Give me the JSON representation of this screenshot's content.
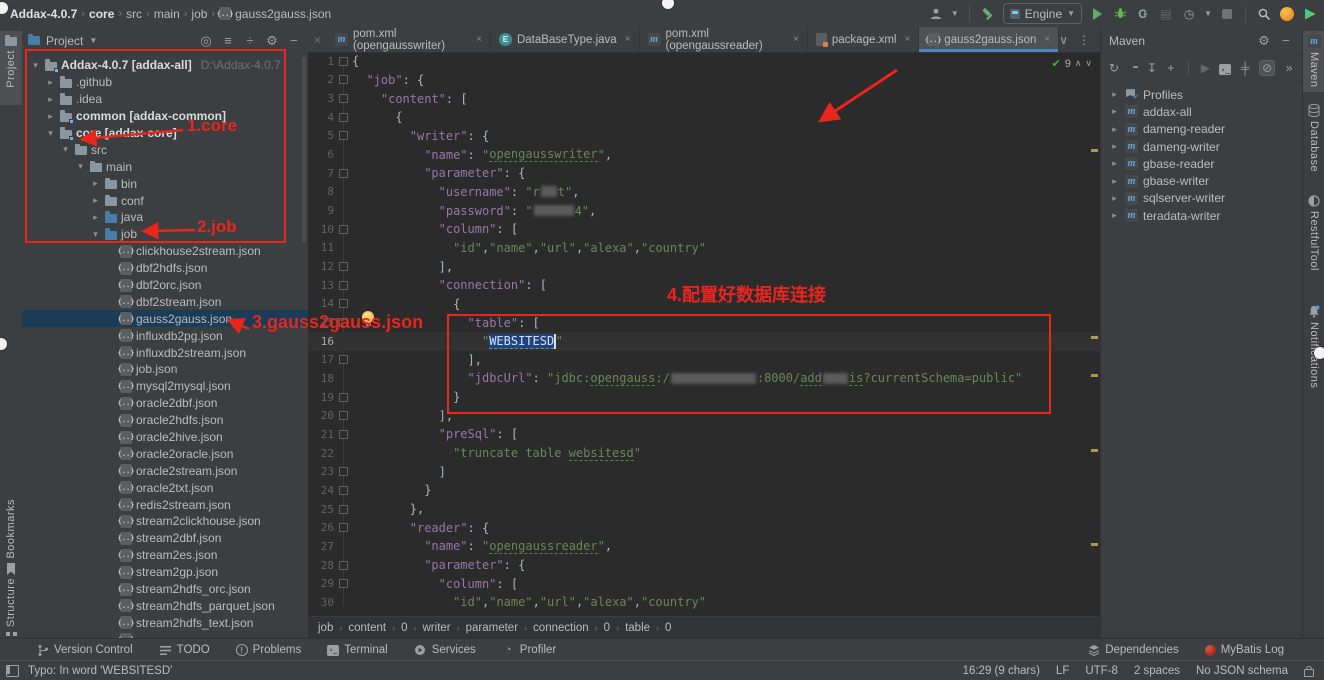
{
  "titlebar": {
    "breadcrumbs": [
      "Addax-4.0.7",
      "core",
      "src",
      "main",
      "job",
      "gauss2gauss.json"
    ],
    "run_config": "Engine"
  },
  "tabs": [
    {
      "icon": "maven",
      "label": "pom.xml (opengausswriter)"
    },
    {
      "icon": "enum",
      "label": "DataBaseType.java"
    },
    {
      "icon": "maven",
      "label": "pom.xml (opengaussreader)"
    },
    {
      "icon": "pkg",
      "label": "package.xml"
    },
    {
      "icon": "json",
      "label": "gauss2gauss.json",
      "active": true
    }
  ],
  "inspection": {
    "count": "9"
  },
  "project": {
    "title": "Project",
    "tree": [
      {
        "l": 0,
        "a": "v",
        "i": "module",
        "t": "Addax-4.0.7 [addax-all]",
        "b": true,
        "suf": "D:\\Addax-4.0.7"
      },
      {
        "l": 1,
        "a": ">",
        "i": "folder",
        "t": ".github"
      },
      {
        "l": 1,
        "a": ">",
        "i": "folder",
        "t": ".idea"
      },
      {
        "l": 1,
        "a": ">",
        "i": "module",
        "t": "common [addax-common]",
        "b": true
      },
      {
        "l": 1,
        "a": "v",
        "i": "module",
        "t": "core [addax-core]",
        "b": true
      },
      {
        "l": 2,
        "a": "v",
        "i": "folder",
        "t": "src"
      },
      {
        "l": 3,
        "a": "v",
        "i": "folder",
        "t": "main"
      },
      {
        "l": 4,
        "a": ">",
        "i": "folder",
        "t": "bin"
      },
      {
        "l": 4,
        "a": ">",
        "i": "folder",
        "t": "conf"
      },
      {
        "l": 4,
        "a": ">",
        "i": "folderb",
        "t": "java"
      },
      {
        "l": 4,
        "a": "v",
        "i": "folderb",
        "t": "job"
      },
      {
        "l": 5,
        "a": "",
        "i": "json",
        "t": "clickhouse2stream.json"
      },
      {
        "l": 5,
        "a": "",
        "i": "json",
        "t": "dbf2hdfs.json"
      },
      {
        "l": 5,
        "a": "",
        "i": "json",
        "t": "dbf2orc.json"
      },
      {
        "l": 5,
        "a": "",
        "i": "json",
        "t": "dbf2stream.json"
      },
      {
        "l": 5,
        "a": "",
        "i": "json",
        "t": "gauss2gauss.json",
        "sel": true
      },
      {
        "l": 5,
        "a": "",
        "i": "json",
        "t": "influxdb2pg.json"
      },
      {
        "l": 5,
        "a": "",
        "i": "json",
        "t": "influxdb2stream.json"
      },
      {
        "l": 5,
        "a": "",
        "i": "json",
        "t": "job.json"
      },
      {
        "l": 5,
        "a": "",
        "i": "json",
        "t": "mysql2mysql.json"
      },
      {
        "l": 5,
        "a": "",
        "i": "json",
        "t": "oracle2dbf.json"
      },
      {
        "l": 5,
        "a": "",
        "i": "json",
        "t": "oracle2hdfs.json"
      },
      {
        "l": 5,
        "a": "",
        "i": "json",
        "t": "oracle2hive.json"
      },
      {
        "l": 5,
        "a": "",
        "i": "json",
        "t": "oracle2oracle.json"
      },
      {
        "l": 5,
        "a": "",
        "i": "json",
        "t": "oracle2stream.json"
      },
      {
        "l": 5,
        "a": "",
        "i": "json",
        "t": "oracle2txt.json"
      },
      {
        "l": 5,
        "a": "",
        "i": "json",
        "t": "redis2stream.json"
      },
      {
        "l": 5,
        "a": "",
        "i": "json",
        "t": "stream2clickhouse.json"
      },
      {
        "l": 5,
        "a": "",
        "i": "json",
        "t": "stream2dbf.json"
      },
      {
        "l": 5,
        "a": "",
        "i": "json",
        "t": "stream2es.json"
      },
      {
        "l": 5,
        "a": "",
        "i": "json",
        "t": "stream2gp.json"
      },
      {
        "l": 5,
        "a": "",
        "i": "json",
        "t": "stream2hdfs_orc.json"
      },
      {
        "l": 5,
        "a": "",
        "i": "json",
        "t": "stream2hdfs_parquet.json"
      },
      {
        "l": 5,
        "a": "",
        "i": "json",
        "t": "stream2hdfs_text.json"
      },
      {
        "l": 5,
        "a": "",
        "i": "json",
        "t": ""
      }
    ]
  },
  "editor": {
    "caret_line": 16,
    "lines": [
      {
        "n": 1,
        "ind": 0,
        "f": "o",
        "seg": [
          [
            "p",
            "{"
          ]
        ]
      },
      {
        "n": 2,
        "ind": 2,
        "f": "o",
        "seg": [
          [
            "k",
            "\"job\""
          ],
          [
            "p",
            ": {"
          ]
        ]
      },
      {
        "n": 3,
        "ind": 4,
        "f": "o",
        "seg": [
          [
            "k",
            "\"content\""
          ],
          [
            "p",
            ": ["
          ]
        ]
      },
      {
        "n": 4,
        "ind": 6,
        "f": "o",
        "seg": [
          [
            "p",
            "{"
          ]
        ]
      },
      {
        "n": 5,
        "ind": 8,
        "f": "o",
        "seg": [
          [
            "k",
            "\"writer\""
          ],
          [
            "p",
            ": {"
          ]
        ]
      },
      {
        "n": 6,
        "ind": 10,
        "f": "",
        "seg": [
          [
            "k",
            "\"name\""
          ],
          [
            "p",
            ": "
          ],
          [
            "s",
            "\""
          ],
          [
            "u",
            "opengausswriter"
          ],
          [
            "s",
            "\""
          ],
          [
            "p",
            ","
          ]
        ]
      },
      {
        "n": 7,
        "ind": 10,
        "f": "o",
        "seg": [
          [
            "k",
            "\"parameter\""
          ],
          [
            "p",
            ": {"
          ]
        ]
      },
      {
        "n": 8,
        "ind": 12,
        "f": "",
        "seg": [
          [
            "k",
            "\"username\""
          ],
          [
            "p",
            ": "
          ],
          [
            "s",
            "\"r"
          ],
          [
            "b",
            "16"
          ],
          [
            "s",
            "t\""
          ],
          [
            "p",
            ","
          ]
        ]
      },
      {
        "n": 9,
        "ind": 12,
        "f": "",
        "seg": [
          [
            "k",
            "\"password\""
          ],
          [
            "p",
            ": "
          ],
          [
            "s",
            "\""
          ],
          [
            "b",
            "40"
          ],
          [
            "s",
            "4\""
          ],
          [
            "p",
            ","
          ]
        ]
      },
      {
        "n": 10,
        "ind": 12,
        "f": "o",
        "seg": [
          [
            "k",
            "\"column\""
          ],
          [
            "p",
            ": ["
          ]
        ]
      },
      {
        "n": 11,
        "ind": 14,
        "f": "",
        "seg": [
          [
            "s",
            "\"id\""
          ],
          [
            "p",
            ","
          ],
          [
            "s",
            "\"name\""
          ],
          [
            "p",
            ","
          ],
          [
            "s",
            "\"url\""
          ],
          [
            "p",
            ","
          ],
          [
            "s",
            "\"alexa\""
          ],
          [
            "p",
            ","
          ],
          [
            "s",
            "\"country\""
          ]
        ]
      },
      {
        "n": 12,
        "ind": 12,
        "f": "e",
        "seg": [
          [
            "p",
            "],"
          ]
        ]
      },
      {
        "n": 13,
        "ind": 12,
        "f": "o",
        "seg": [
          [
            "k",
            "\"connection\""
          ],
          [
            "p",
            ": ["
          ]
        ]
      },
      {
        "n": 14,
        "ind": 14,
        "f": "o",
        "seg": [
          [
            "p",
            "{"
          ]
        ]
      },
      {
        "n": 15,
        "ind": 16,
        "f": "o",
        "seg": [
          [
            "k",
            "\"table\""
          ],
          [
            "p",
            ": ["
          ]
        ]
      },
      {
        "n": 16,
        "ind": 18,
        "f": "",
        "seg": [
          [
            "s",
            "\""
          ],
          [
            "sel",
            "WEBSITESD"
          ],
          [
            "c",
            ""
          ],
          [
            "s",
            "\""
          ]
        ]
      },
      {
        "n": 17,
        "ind": 16,
        "f": "e",
        "seg": [
          [
            "p",
            "],"
          ]
        ]
      },
      {
        "n": 18,
        "ind": 16,
        "f": "",
        "seg": [
          [
            "k",
            "\"jdbcUrl\""
          ],
          [
            "p",
            ": "
          ],
          [
            "s",
            "\"jdbc:"
          ],
          [
            "u",
            "opengauss"
          ],
          [
            "s",
            ":/"
          ],
          [
            "b",
            "85"
          ],
          [
            "s",
            ":8000/"
          ],
          [
            "u",
            "add"
          ],
          [
            "b",
            "25"
          ],
          [
            "u",
            "is"
          ],
          [
            "s",
            "?currentSchema=public\""
          ]
        ]
      },
      {
        "n": 19,
        "ind": 14,
        "f": "e",
        "seg": [
          [
            "p",
            "}"
          ]
        ]
      },
      {
        "n": 20,
        "ind": 12,
        "f": "e",
        "seg": [
          [
            "p",
            "],"
          ]
        ]
      },
      {
        "n": 21,
        "ind": 12,
        "f": "o",
        "seg": [
          [
            "k",
            "\"preSql\""
          ],
          [
            "p",
            ": ["
          ]
        ]
      },
      {
        "n": 22,
        "ind": 14,
        "f": "",
        "seg": [
          [
            "s",
            "\"truncate table "
          ],
          [
            "u",
            "websitesd"
          ],
          [
            "s",
            "\""
          ]
        ]
      },
      {
        "n": 23,
        "ind": 12,
        "f": "e",
        "seg": [
          [
            "p",
            "]"
          ]
        ]
      },
      {
        "n": 24,
        "ind": 10,
        "f": "e",
        "seg": [
          [
            "p",
            "}"
          ]
        ]
      },
      {
        "n": 25,
        "ind": 8,
        "f": "e",
        "seg": [
          [
            "p",
            "},"
          ]
        ]
      },
      {
        "n": 26,
        "ind": 8,
        "f": "o",
        "seg": [
          [
            "k",
            "\"reader\""
          ],
          [
            "p",
            ": {"
          ]
        ]
      },
      {
        "n": 27,
        "ind": 10,
        "f": "",
        "seg": [
          [
            "k",
            "\"name\""
          ],
          [
            "p",
            ": "
          ],
          [
            "s",
            "\""
          ],
          [
            "u",
            "opengaussreader"
          ],
          [
            "s",
            "\""
          ],
          [
            "p",
            ","
          ]
        ]
      },
      {
        "n": 28,
        "ind": 10,
        "f": "o",
        "seg": [
          [
            "k",
            "\"parameter\""
          ],
          [
            "p",
            ": {"
          ]
        ]
      },
      {
        "n": 29,
        "ind": 12,
        "f": "o",
        "seg": [
          [
            "k",
            "\"column\""
          ],
          [
            "p",
            ": ["
          ]
        ]
      },
      {
        "n": 30,
        "ind": 14,
        "f": "",
        "seg": [
          [
            "s",
            "\"id\""
          ],
          [
            "p",
            ","
          ],
          [
            "s",
            "\"name\""
          ],
          [
            "p",
            ","
          ],
          [
            "s",
            "\"url\""
          ],
          [
            "p",
            ","
          ],
          [
            "s",
            "\"alexa\""
          ],
          [
            "p",
            ","
          ],
          [
            "s",
            "\"country\""
          ]
        ]
      }
    ],
    "breadcrumb": [
      "job",
      "content",
      "0",
      "writer",
      "parameter",
      "connection",
      "0",
      "table",
      "0"
    ]
  },
  "maven": {
    "title": "Maven",
    "items": [
      {
        "icon": "profiles",
        "label": "Profiles"
      },
      {
        "icon": "maven",
        "label": "addax-all"
      },
      {
        "icon": "maven",
        "label": "dameng-reader"
      },
      {
        "icon": "maven",
        "label": "dameng-writer"
      },
      {
        "icon": "maven",
        "label": "gbase-reader"
      },
      {
        "icon": "maven",
        "label": "gbase-writer"
      },
      {
        "icon": "maven",
        "label": "sqlserver-writer"
      },
      {
        "icon": "maven",
        "label": "teradata-writer"
      }
    ]
  },
  "left_bar": {
    "top": [
      {
        "icon": "folder",
        "label": "Project",
        "active": true
      }
    ],
    "bottom": [
      {
        "icon": "bookmark",
        "label": "Bookmarks"
      },
      {
        "icon": "structure",
        "label": "Structure"
      }
    ]
  },
  "right_bar": [
    {
      "icon": "maven",
      "label": "Maven",
      "active": true
    },
    {
      "icon": "db",
      "label": "Database"
    },
    {
      "icon": "rest",
      "label": "RestfulTool"
    },
    {
      "icon": "bell",
      "label": "Notifications"
    }
  ],
  "bottom_bar": {
    "left": [
      {
        "icon": "branch",
        "label": "Version Control"
      },
      {
        "icon": "todo",
        "label": "TODO"
      },
      {
        "icon": "problem",
        "label": "Problems"
      },
      {
        "icon": "terminal",
        "label": "Terminal"
      },
      {
        "icon": "services",
        "label": "Services"
      },
      {
        "icon": "profiler",
        "label": "Profiler"
      }
    ],
    "right": [
      {
        "icon": "deps",
        "label": "Dependencies"
      },
      {
        "icon": "mybatis",
        "label": "MyBatis Log"
      }
    ]
  },
  "status_bar": {
    "left": "Typo: In word 'WEBSITESD'",
    "right": [
      "16:29 (9 chars)",
      "LF",
      "UTF-8",
      "2 spaces",
      "No JSON schema"
    ]
  },
  "annotations": {
    "a1": "1.core",
    "a2": "2.job",
    "a3": "3.gauss2gauss.json",
    "a4": "4.配置好数据库连接"
  },
  "colors": {
    "accent": "#4a88c7",
    "annotation_red": "#e8261d",
    "json_key": "#9876aa",
    "json_string": "#6a8759",
    "punct": "#a9b7c6",
    "selection": "#214283"
  }
}
